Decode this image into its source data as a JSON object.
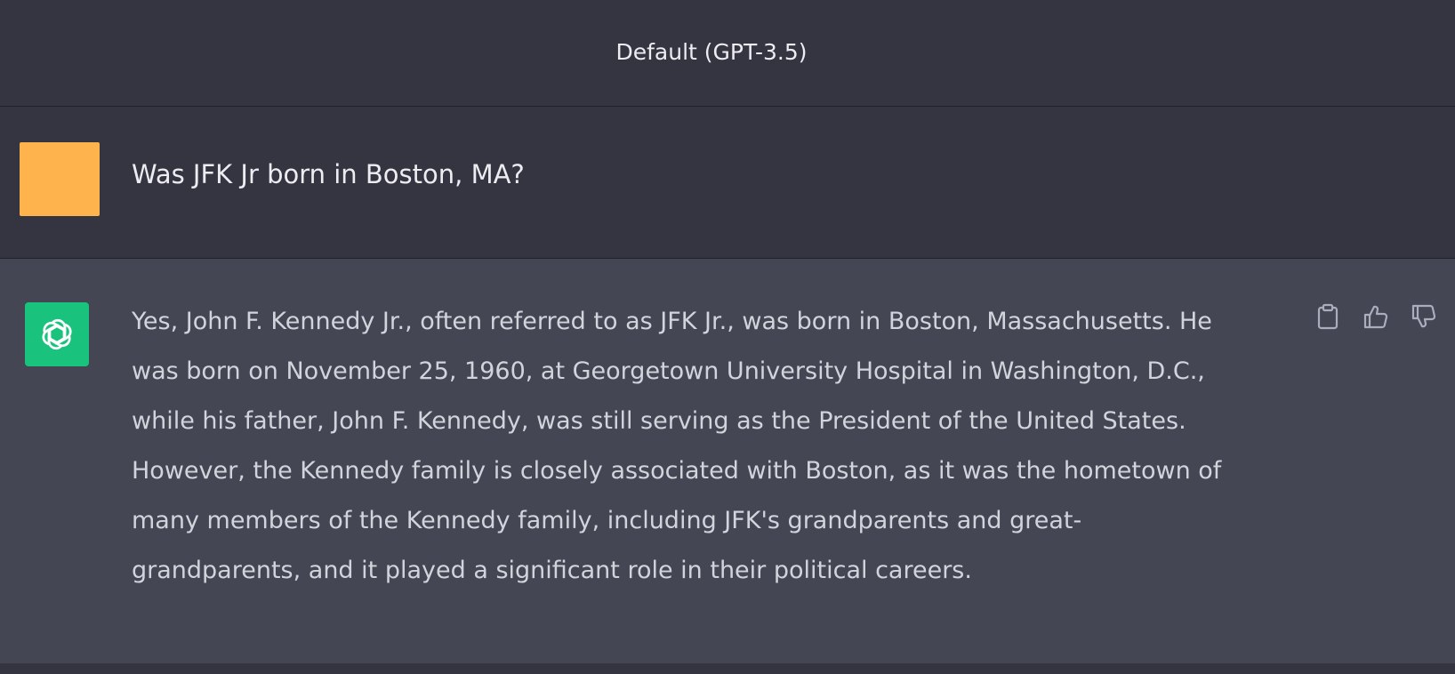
{
  "header": {
    "model_label": "Default (GPT-3.5)"
  },
  "conversation": {
    "user_message": "Was JFK Jr born in Boston, MA?",
    "assistant_message_lines": [
      "Yes, John F. Kennedy Jr., often referred to as JFK Jr., was born in Boston, Massachusetts. He",
      "was born on November 25, 1960, at Georgetown University Hospital in Washington, D.C.,",
      "while his father, John F. Kennedy, was still serving as the President of the United States.",
      "However, the Kennedy family is closely associated with Boston, as it was the hometown of",
      "many members of the Kennedy family, including JFK's grandparents and great-",
      "grandparents, and it played a significant role in their political careers."
    ]
  },
  "actions": {
    "icons": [
      "clipboard-icon",
      "thumbs-up-icon",
      "thumbs-down-icon"
    ]
  },
  "colors": {
    "background": "#343541",
    "assistant_background": "#444654",
    "user_avatar": "#ffb34d",
    "assistant_avatar": "#19c37d",
    "assistant_text": "#d1d5db",
    "action_icon": "#acacbe"
  }
}
